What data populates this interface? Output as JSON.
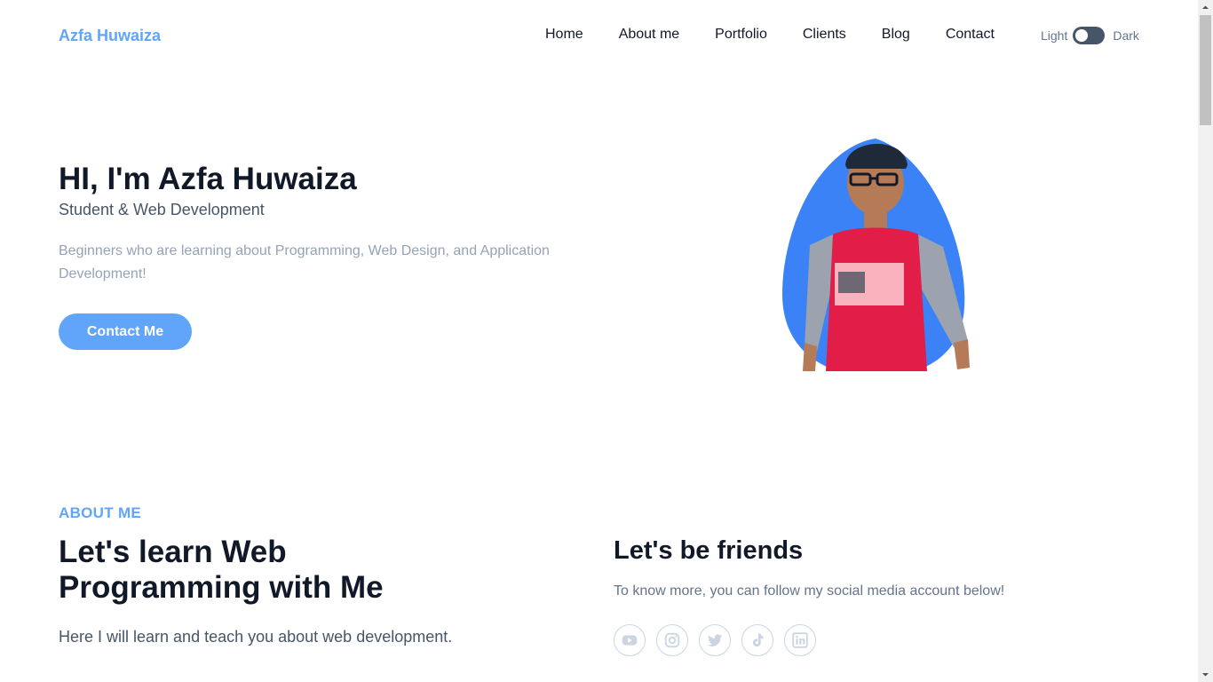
{
  "nav": {
    "brand": "Azfa Huwaiza",
    "items": [
      "Home",
      "About me",
      "Portfolio",
      "Clients",
      "Blog",
      "Contact"
    ],
    "theme_light": "Light",
    "theme_dark": "Dark"
  },
  "hero": {
    "title": "HI, I'm Azfa Huwaiza",
    "subtitle": "Student & Web Development",
    "description": "Beginners who are learning about Programming, Web Design, and Application Development!",
    "cta": "Contact Me"
  },
  "about": {
    "eyebrow": "ABOUT ME",
    "title": "Let's learn Web Programming with Me",
    "description": "Here I will learn and teach you about web development."
  },
  "friends": {
    "title": "Let's be friends",
    "description": "To know more, you can follow my social media account below!",
    "socials": [
      "youtube-icon",
      "instagram-icon",
      "twitter-icon",
      "tiktok-icon",
      "linkedin-icon"
    ]
  },
  "colors": {
    "accent": "#60a5fa",
    "blob": "#3b82f6",
    "text": "#111827",
    "muted": "#94a3b8"
  }
}
